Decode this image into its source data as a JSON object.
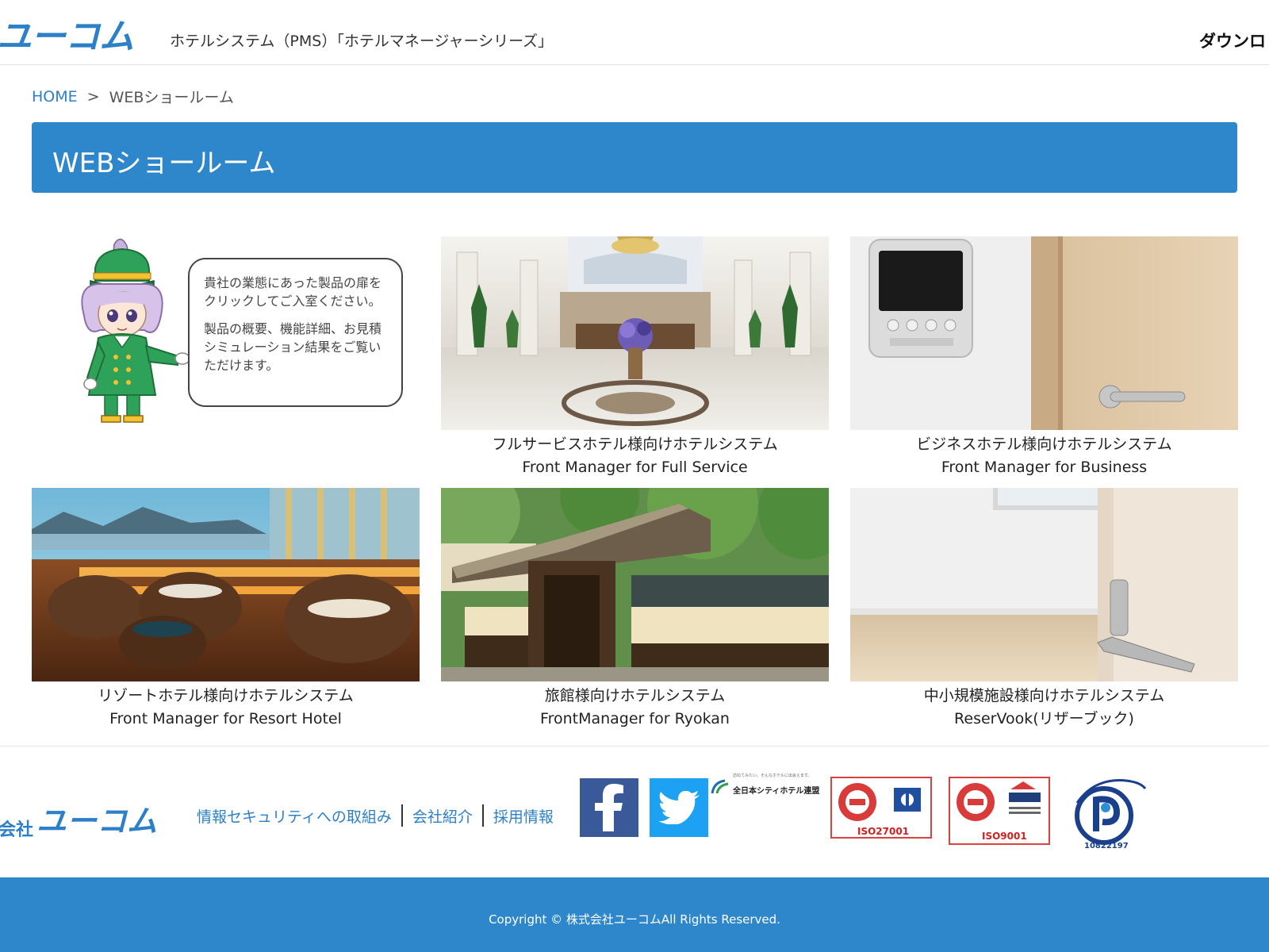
{
  "header": {
    "logo_text": "ユーコム",
    "tagline": "ホテルシステム（PMS）「ホテルマネージャーシリーズ」",
    "download_label": "ダウンロ"
  },
  "breadcrumb": {
    "home": "HOME",
    "separator": ">",
    "current": "WEBショールーム"
  },
  "page": {
    "title": "WEBショールーム"
  },
  "intro": {
    "bubble_line1": "貴社の業態にあった製品の扉をクリックしてご入室ください。",
    "bubble_line2": "製品の概要、機能詳細、お見積シミュレーション結果をご覧いただけます。"
  },
  "cards": [
    {
      "title": "フルサービスホテル様向けホテルシステム",
      "subtitle": "Front Manager for Full Service"
    },
    {
      "title": "ビジネスホテル様向けホテルシステム",
      "subtitle": "Front Manager for Business"
    },
    {
      "title": "リゾートホテル様向けホテルシステム",
      "subtitle": "Front Manager for Resort Hotel"
    },
    {
      "title": "旅館様向けホテルシステム",
      "subtitle": "FrontManager for Ryokan"
    },
    {
      "title": "中小規模施設様向けホテルシステム",
      "subtitle": "ReserVook(リザーブック)"
    }
  ],
  "footer": {
    "company_prefix": "会社",
    "logo_text": "ユーコム",
    "links": [
      "情報セキュリティへの取組み",
      "会社紹介",
      "採用情報"
    ],
    "jcha_tagline": "訪ねてみたい。そんなホテルに出会えます。",
    "jcha_name": "全日本シティホテル連盟",
    "cert1_label": "ISO27001",
    "cert2_label": "ISO9001",
    "pmark_number": "10822197",
    "copyright": "Copyright © 株式会社ユーコムAll Rights Reserved."
  },
  "colors": {
    "brand_blue": "#2f87cb",
    "link_blue": "#2c7fc9",
    "facebook": "#3a5998",
    "twitter": "#1da1f2",
    "cert_red": "#d94242"
  }
}
